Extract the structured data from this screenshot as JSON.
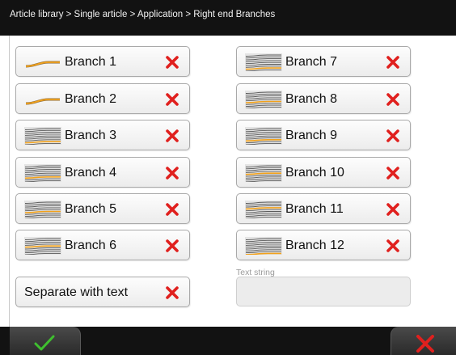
{
  "breadcrumb": "Article library > Single article > Application > Right end Branches",
  "branches_left": [
    {
      "label": "Branch 1",
      "icon": "single-wire-icon"
    },
    {
      "label": "Branch 2",
      "icon": "single-wire-icon"
    },
    {
      "label": "Branch 3",
      "icon": "wire-bundle-icon"
    },
    {
      "label": "Branch 4",
      "icon": "wire-bundle-icon"
    },
    {
      "label": "Branch 5",
      "icon": "wire-bundle-icon"
    },
    {
      "label": "Branch 6",
      "icon": "wire-bundle-icon"
    }
  ],
  "branches_right": [
    {
      "label": "Branch 7",
      "icon": "wire-bundle-icon"
    },
    {
      "label": "Branch 8",
      "icon": "wire-bundle-icon"
    },
    {
      "label": "Branch 9",
      "icon": "wire-bundle-icon"
    },
    {
      "label": "Branch 10",
      "icon": "wire-bundle-icon"
    },
    {
      "label": "Branch 11",
      "icon": "wire-bundle-icon"
    },
    {
      "label": "Branch 12",
      "icon": "wire-bundle-icon"
    }
  ],
  "separate_label": "Separate with text",
  "text_string_label": "Text string",
  "text_string_value": "",
  "colors": {
    "wire_orange": "#f2a21c",
    "delete_red": "#e0201e",
    "confirm_green": "#3fbf2f",
    "bar_dark": "#121212"
  }
}
